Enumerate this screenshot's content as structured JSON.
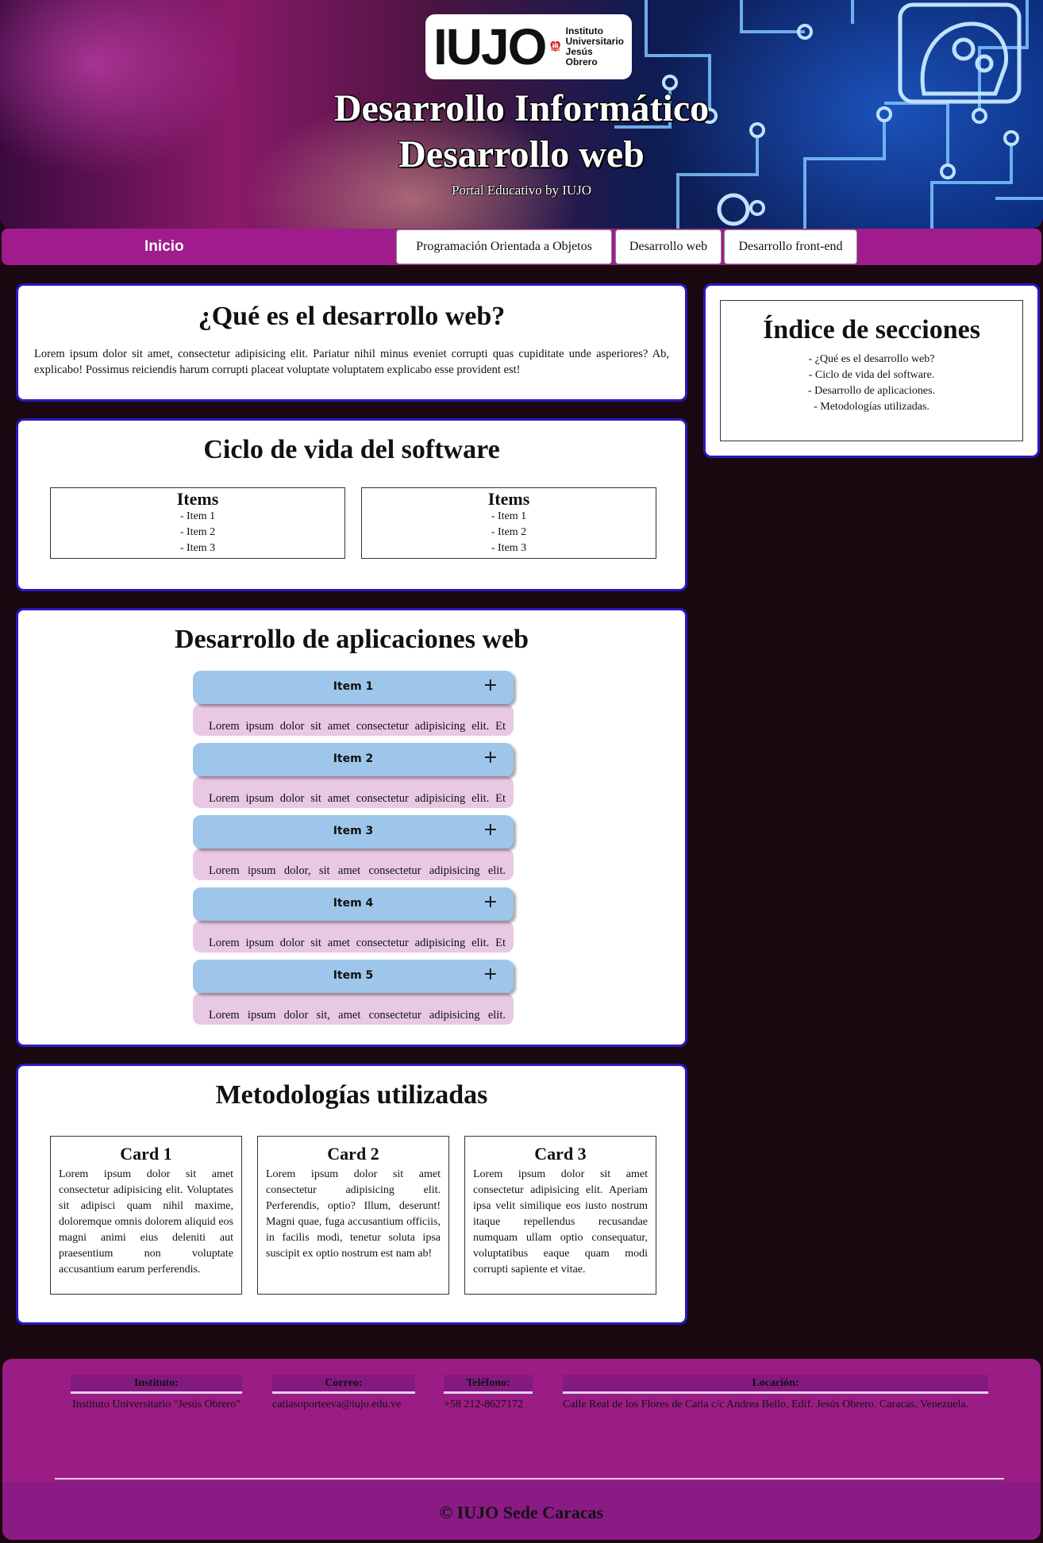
{
  "header": {
    "logo_text": "IUJO",
    "logo_sub": [
      "Instituto",
      "Universitario",
      "Jesús",
      "Obrero"
    ],
    "logo_badge": "FE Y ALEGRÍA",
    "title_line1": "Desarrollo Informático",
    "title_line2": "Desarrollo web",
    "subtitle": "Portal Educativo by IUJO"
  },
  "nav": {
    "home": "Inicio",
    "items": [
      {
        "label": "Programación Orientada a Objetos"
      },
      {
        "label": "Desarrollo web"
      },
      {
        "label": "Desarrollo front-end"
      }
    ]
  },
  "intro": {
    "title": "¿Qué es el desarrollo web?",
    "text": "Lorem ipsum dolor sit amet, consectetur adipisicing elit. Pariatur nihil minus eveniet corrupti quas cupiditate unde asperiores? Ab, explicabo! Possimus reiciendis harum corrupti placeat voluptate voluptatem explicabo esse provident est!"
  },
  "lifecycle": {
    "title": "Ciclo de vida del software",
    "boxes": [
      {
        "title": "Items",
        "lines": [
          "- Item 1",
          "- Item 2",
          "- Item 3"
        ]
      },
      {
        "title": "Items",
        "lines": [
          "- Item 1",
          "- Item 2",
          "- Item 3"
        ]
      }
    ]
  },
  "apps": {
    "title": "Desarrollo de aplicaciones web",
    "items": [
      {
        "label": "Item 1",
        "icon": "+",
        "text": "Lorem ipsum dolor sit amet consectetur adipisicing elit. Et"
      },
      {
        "label": "Item 2",
        "icon": "+",
        "text": "Lorem ipsum dolor sit amet consectetur adipisicing elit. Et"
      },
      {
        "label": "Item 3",
        "icon": "+",
        "text": "Lorem ipsum dolor, sit amet consectetur adipisicing elit."
      },
      {
        "label": "Item 4",
        "icon": "+",
        "text": "Lorem ipsum dolor sit amet consectetur adipisicing elit. Et"
      },
      {
        "label": "Item 5",
        "icon": "+",
        "text": "Lorem ipsum dolor sit, amet consectetur adipisicing elit."
      }
    ]
  },
  "methods": {
    "title": "Metodologías utilizadas",
    "cards": [
      {
        "title": "Card 1",
        "text": "Lorem ipsum dolor sit amet consectetur adipisicing elit. Voluptates sit adipisci quam nihil maxime, doloremque omnis dolorem aliquid eos magni animi eius deleniti aut praesentium non voluptate accusantium earum perferendis."
      },
      {
        "title": "Card 2",
        "text": "Lorem ipsum dolor sit amet consectetur adipisicing elit. Perferendis, optio? Illum, deserunt! Magni quae, fuga accusantium officiis, in facilis modi, tenetur soluta ipsa suscipit ex optio nostrum est nam ab!"
      },
      {
        "title": "Card 3",
        "text": "Lorem ipsum dolor sit amet consectetur adipisicing elit. Aperiam ipsa velit similique eos iusto nostrum itaque repellendus recusandae numquam ullam optio consequatur, voluptatibus eaque quam modi corrupti sapiente et vitae."
      }
    ]
  },
  "index": {
    "title": "Índice de secciones",
    "lines": [
      "- ¿Qué es el desarrollo web?",
      "- Ciclo de vida del software.",
      "- Desarrollo de aplicaciones.",
      "- Metodologías utilizadas."
    ]
  },
  "footer": {
    "institute_label": "Instituto:",
    "institute_value": "Instituto Universitario \"Jesús Obrero\"",
    "email_label": "Correo:",
    "email_value": "catiasoporteeva@iujo.edu.ve",
    "phone_label": "Teléfono:",
    "phone_value": "+58 212-8627172",
    "location_label": "Locación:",
    "location_value": "Calle Real de los Flores de Catia c/c Andrea Bello, Edif. Jesús Obrero. Caracas, Venezuela.",
    "copyright": "© IUJO Sede Caracas"
  },
  "colors": {
    "nav_bg": "#a01c8c",
    "panel_border": "#2a1ac0",
    "accordion_head": "#9ec6ea",
    "accordion_body": "#e8c8e2",
    "footer_bg": "#9c1c86",
    "page_bg": "#1a0810"
  }
}
